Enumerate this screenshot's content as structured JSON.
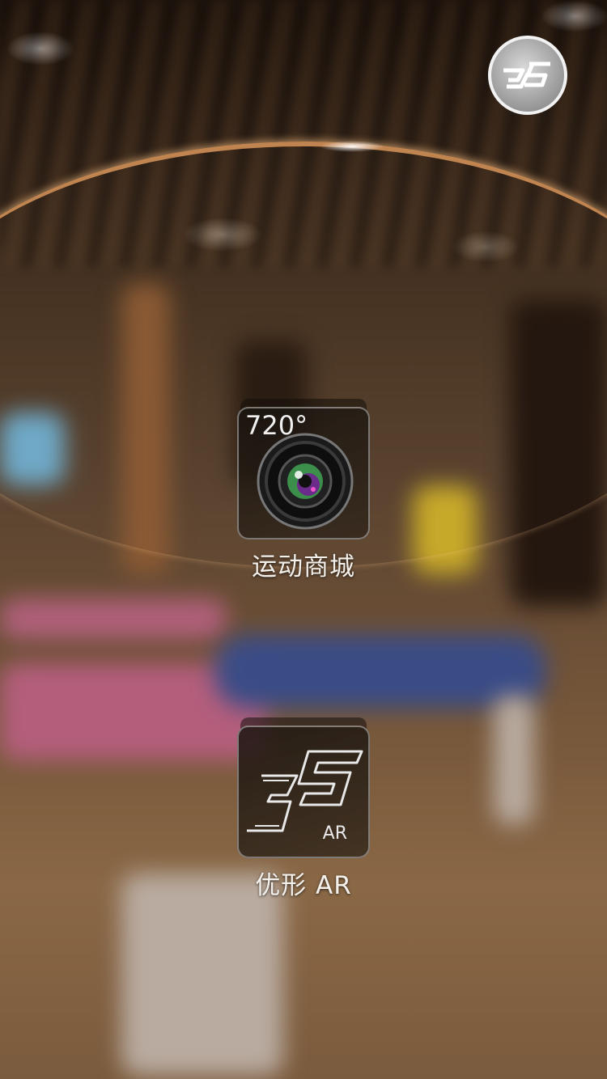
{
  "header": {
    "logo_icon": "logo-5g-icon"
  },
  "apps": [
    {
      "badge": "720°",
      "icon": "camera-lens-icon",
      "label": "运动商城"
    },
    {
      "badge": "AR",
      "icon": "logo-5g-icon",
      "label": "优形 AR"
    }
  ],
  "colors": {
    "arc": "#c08450",
    "label": "#f4f1ec"
  }
}
